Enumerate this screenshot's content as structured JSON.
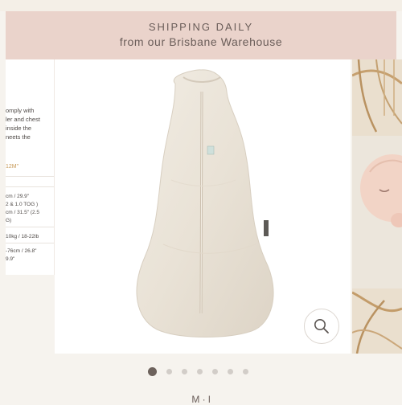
{
  "banner": {
    "title": "SHIPPING DAILY",
    "subtitle": "from our Brisbane Warehouse"
  },
  "details_panel": {
    "description": "omply with\nler and chest\ninside the\nneets the",
    "size": "12M\"",
    "spec_length": "cm / 29.9\"\n2 & 1.0 TOG )\ncm / 31.5\" (2.5\nG)",
    "spec_weight": "10kg / 18-22lb",
    "spec_height": "-76cm / 26.8\"\n9.9\""
  },
  "gallery": {
    "image_count": 7,
    "active_index": 0,
    "zoom_icon": "magnifier-icon"
  },
  "footer": {
    "partial_text": "M  · l"
  },
  "colors": {
    "banner_bg": "#ead3cb",
    "page_bg": "#f6f3ee",
    "active_dot": "#6d625c",
    "inactive_dot": "#d2cdc8"
  }
}
